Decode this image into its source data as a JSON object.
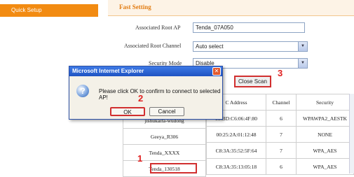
{
  "sidebar": {
    "active_item": "Quick Setup"
  },
  "main": {
    "title": "Fast Setting",
    "form": {
      "root_ap_label": "Associated Root AP",
      "root_ap_value": "Tenda_07A050",
      "root_channel_label": "Associated Root Channel",
      "root_channel_value": "Auto select",
      "security_mode_label": "Security Mode",
      "security_mode_value": "Disable",
      "close_scan_label": "Close Scan"
    },
    "table": {
      "headers": [
        "C Address",
        "Channel",
        "Security"
      ],
      "rows": [
        {
          "ssid": "jishukaifa-wudong",
          "mac": "00:BD:C6:06:4F:80",
          "channel": "6",
          "security": "WPAWPA2_AESTK"
        },
        {
          "ssid": "Geeya_R306",
          "mac": "00:25:2A:01:12:48",
          "channel": "7",
          "security": "NONE"
        },
        {
          "ssid": "Tenda_XXXX",
          "mac": "C8:3A:35:52:5F:64",
          "channel": "7",
          "security": "WPA_AES"
        },
        {
          "ssid": "Tenda_130518",
          "mac": "C8:3A:35:13:05:18",
          "channel": "6",
          "security": "WPA_AES"
        }
      ]
    }
  },
  "dialog": {
    "title": "Microsoft Internet Explorer",
    "message": "Please click OK to confirm to connect to selected AP!",
    "ok_label": "OK",
    "cancel_label": "Cancel"
  },
  "steps": {
    "one": "1",
    "two": "2",
    "three": "3"
  },
  "colors": {
    "accent": "#f28b12",
    "highlight": "#d12f2f",
    "dialog_title": "#1f53c2"
  }
}
